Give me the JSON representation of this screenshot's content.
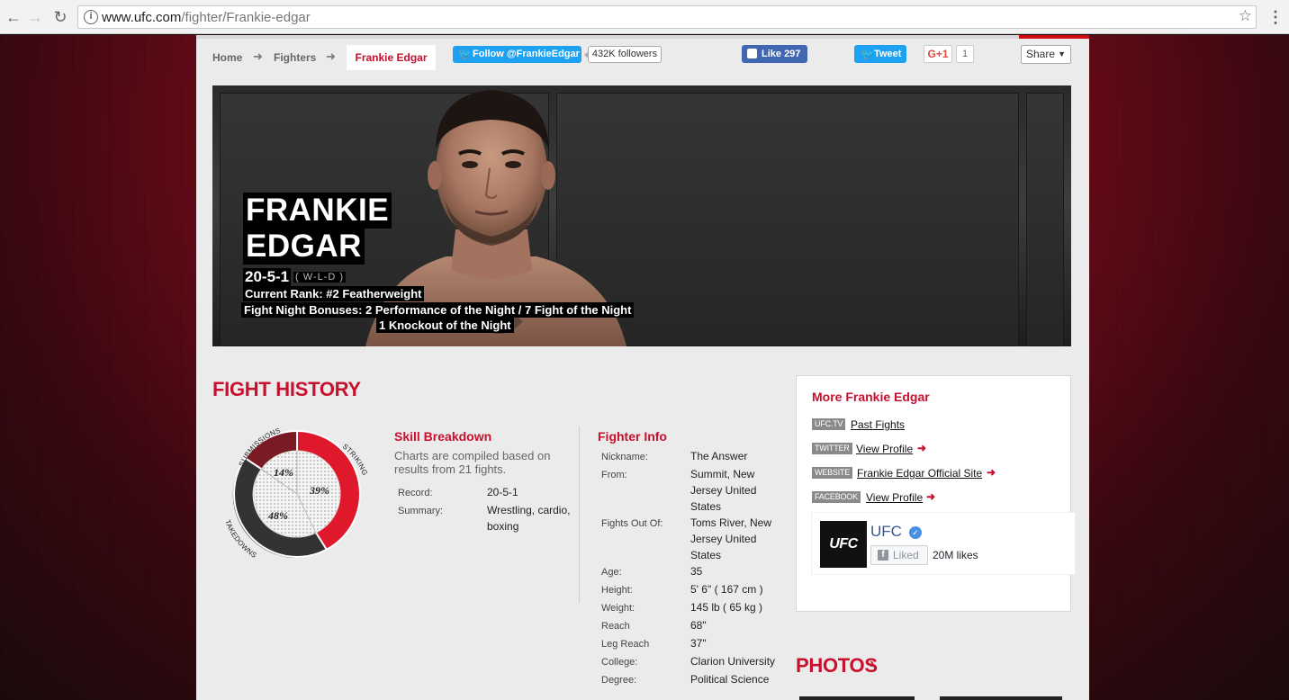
{
  "browser": {
    "url_domain": "www.ufc.com",
    "url_path": "/fighter/Frankie-edgar",
    "info_icon": "i",
    "star_icon": "☆",
    "menu_icon": "⋮"
  },
  "breadcrumb": {
    "home": "Home",
    "fighters": "Fighters",
    "current": "Frankie Edgar"
  },
  "social": {
    "twitter_follow": "Follow @FrankieEdgar",
    "twitter_followers": "432K followers",
    "fb_like": "Like 297",
    "tweet": "Tweet",
    "gplus": "G+1",
    "gplus_count": "1",
    "share": "Share"
  },
  "hero": {
    "first_name": "FRANKIE",
    "last_name": "EDGAR",
    "record": "20-5-1",
    "record_legend": "( W-L-D )",
    "rank": "Current Rank: #2 Featherweight",
    "bonuses_line1": "Fight Night Bonuses: 2 Performance of the Night / 7 Fight of the Night",
    "bonuses_line2": "1 Knockout of the Night"
  },
  "fight_history": {
    "title": "FIGHT HISTORY",
    "chart": {
      "labels": {
        "submissions": "SUBMISSIONS",
        "striking": "STRIKING",
        "takedowns": "TAKEDOWNS"
      },
      "values": {
        "submissions": "14%",
        "striking": "39%",
        "takedowns": "48%"
      },
      "colors": {
        "submissions": "#7a1a24",
        "striking": "#e0182b",
        "takedowns": "#333333"
      }
    }
  },
  "skill_breakdown": {
    "title": "Skill Breakdown",
    "note": "Charts are compiled based on results from 21 fights.",
    "record_label": "Record:",
    "record_value": "20-5-1",
    "summary_label": "Summary:",
    "summary_value": "Wrestling, cardio, boxing"
  },
  "fighter_info": {
    "title": "Fighter Info",
    "rows": [
      {
        "label": "Nickname:",
        "value": "The Answer"
      },
      {
        "label": "From:",
        "value": "Summit, New Jersey United States"
      },
      {
        "label": "Fights Out Of:",
        "value": "Toms River, New Jersey United States"
      },
      {
        "label": "Age:",
        "value": "35"
      },
      {
        "label": "Height:",
        "value": "5' 6\" ( 167 cm )"
      },
      {
        "label": "Weight:",
        "value": "145 lb ( 65 kg )"
      },
      {
        "label": "Reach",
        "value": "68\""
      },
      {
        "label": "Leg Reach",
        "value": "37\""
      },
      {
        "label": "College:",
        "value": "Clarion University"
      },
      {
        "label": "Degree:",
        "value": "Political Science"
      }
    ]
  },
  "more": {
    "title": "More Frankie Edgar",
    "links": [
      {
        "tag": "UFC.TV",
        "text": "Past Fights"
      },
      {
        "tag": "TWITTER",
        "text": "View Profile"
      },
      {
        "tag": "WEBSITE",
        "text": "Frankie Edgar Official Site"
      },
      {
        "tag": "FACEBOOK",
        "text": "View Profile"
      }
    ],
    "fb_page": {
      "logo": "UFC",
      "name": "UFC",
      "liked": "Liked",
      "likes": "20M likes"
    }
  },
  "photos": {
    "title": "PHOTOS",
    "chevron": "›"
  },
  "colors": {
    "brand_red": "#c8102e",
    "panel": "#ebebeb",
    "twitter": "#1da1f2",
    "facebook": "#4267b2"
  }
}
